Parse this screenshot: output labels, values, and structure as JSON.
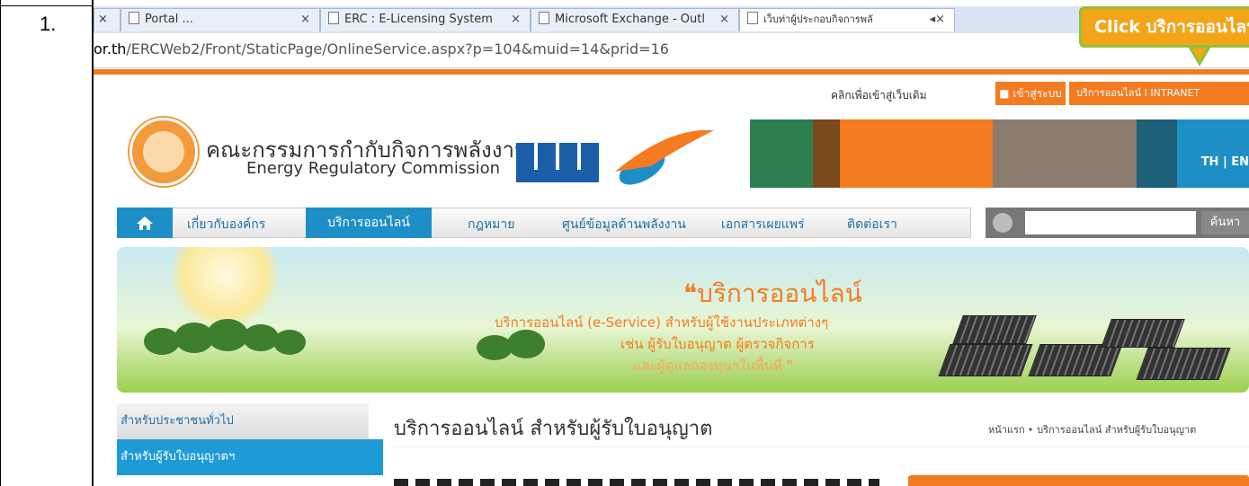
{
  "step": {
    "number": "1."
  },
  "browser": {
    "tabs": [
      {
        "label": "Portal ..."
      },
      {
        "label": "ERC : E-Licensing System"
      },
      {
        "label": "Microsoft Exchange - Outl"
      },
      {
        "label": "เว็บท่าผู้ประกอบกิจการพลั"
      }
    ],
    "first_tab_close": "×",
    "url_domain": "or.th",
    "url_path": "/ERCWeb2/Front/StaticPage/OnlineService.aspx?p=104&muid=14&prid=16"
  },
  "site": {
    "old_site_link": "คลิกเพื่อเข้าสู่เว็บเดิม",
    "login_button": "เข้าสู่ระบบ",
    "eservice_intranet": "บริการออนไลน์ I INTRANET",
    "lang": "TH | EN",
    "org_name_th": "คณะกรรมการกำกับกิจการพลังงาน",
    "org_name_en": "Energy Regulatory Commission",
    "logo_text": "ERC",
    "nav": [
      {
        "label": "เกี่ยวกับองค์กร"
      },
      {
        "label": "บริการออนไลน์"
      },
      {
        "label": "กฎหมาย"
      },
      {
        "label": "ศูนย์ข้อมูลด้านพลังงาน"
      },
      {
        "label": "เอกสารเผยแพร่"
      },
      {
        "label": "ติดต่อเรา"
      }
    ],
    "search_button": "ค้นหา",
    "banner": {
      "title": "❝บริการออนไลน์",
      "line1": "บริการออนไลน์ (e-Service) สำหรับผู้ใช้งานประเภทต่างๆ",
      "line2": "เช่น ผู้รับใบอนุญาต ผู้ตรวจกิจการ",
      "line3": "และผู้ดูแลกองทุนฯในพื้นที่ ❞"
    },
    "sidebar": [
      {
        "label": "สำหรับประชาชนทั่วไป"
      },
      {
        "label": "สำหรับผู้รับใบอนุญาตฯ"
      }
    ],
    "content_title": "บริการออนไลน์ สำหรับผู้รับใบอนุญาต",
    "breadcrumb": "หน้าแรก ‣ บริการออนไลน์ สำหรับผู้รับใบอนุญาต"
  },
  "callout": {
    "text": "Click บริการออนไลน์"
  },
  "colors": {
    "accent": "#f47b20",
    "nav_blue": "#1e8fc6",
    "callout_fill": "#f3a51a",
    "callout_border": "#8fc23c"
  }
}
